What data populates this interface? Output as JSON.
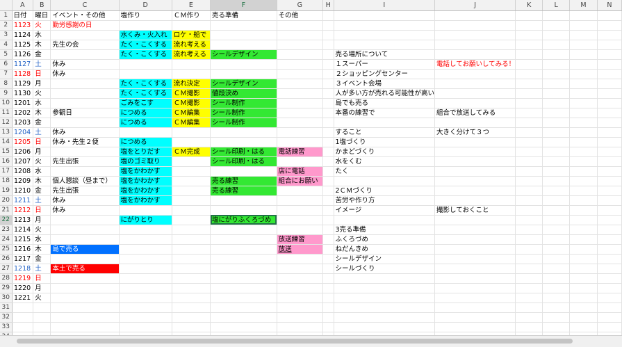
{
  "columns": [
    "",
    "A",
    "B",
    "C",
    "D",
    "E",
    "F",
    "G",
    "H",
    "I",
    "J",
    "K",
    "L",
    "M",
    "N"
  ],
  "colors": {
    "cyan": "#00ffff",
    "yellow": "#ffff00",
    "green": "#33e833",
    "pink": "#ff99cc",
    "blue": "#0070ff",
    "red": "#ff0000",
    "weekend_blue": "#1f5fc4"
  },
  "active_cell": "F22",
  "rows": [
    {
      "n": 1,
      "A": "日付",
      "B": "曜日",
      "C": "イベント・その他",
      "D": "塩作り",
      "E": "ＣＭ作り",
      "F": "売る準備",
      "G": "その他"
    },
    {
      "n": 2,
      "A": "1123",
      "B": "火",
      "C": "勤労感謝の日",
      "red": true
    },
    {
      "n": 3,
      "A": "1124",
      "B": "水",
      "D": "水くみ・火入れ",
      "E": "ロケ・船で"
    },
    {
      "n": 4,
      "A": "1125",
      "B": "木",
      "C": "先生の会",
      "D": "たく・こくする",
      "E": "流れ考える"
    },
    {
      "n": 5,
      "A": "1126",
      "B": "金",
      "D": "たく・こくする",
      "E": "流れ考える",
      "F": "シールデザイン",
      "I": "売る場所について"
    },
    {
      "n": 6,
      "A": "1127",
      "B": "土",
      "C": "休み",
      "I": "１スーパー",
      "J": "電話してお願いしてみる！",
      "sat": true
    },
    {
      "n": 7,
      "A": "1128",
      "B": "日",
      "C": "休み",
      "I": "２ショッピングセンター",
      "red": true
    },
    {
      "n": 8,
      "A": "1129",
      "B": "月",
      "D": "たく・こくする",
      "E": "流れ決定",
      "F": "シールデザイン",
      "I": "３イベント会場"
    },
    {
      "n": 9,
      "A": "1130",
      "B": "火",
      "D": "たく・こくする",
      "E": "ＣＭ撮影",
      "F": "値段決め",
      "I": "人が多い方が売れる可能性が高い"
    },
    {
      "n": 10,
      "A": "1201",
      "B": "水",
      "D": "ごみをこす",
      "E": "ＣＭ撮影",
      "F": "シール制作",
      "I": "島でも売る"
    },
    {
      "n": 11,
      "A": "1202",
      "B": "木",
      "C": "参観日",
      "D": "につめる",
      "E": "ＣＭ編集",
      "F": "シール制作",
      "I": "本番の練習で",
      "J": "組合で放送してみる"
    },
    {
      "n": 12,
      "A": "1203",
      "B": "金",
      "D": "につめる",
      "E": "ＣＭ編集",
      "F": "シール制作"
    },
    {
      "n": 13,
      "A": "1204",
      "B": "土",
      "C": "休み",
      "I": "すること",
      "J": "大きく分けて３つ",
      "sat": true
    },
    {
      "n": 14,
      "A": "1205",
      "B": "日",
      "C": "休み・先生２便",
      "D": "につめる",
      "I": "1塩づくり",
      "red": true
    },
    {
      "n": 15,
      "A": "1206",
      "B": "月",
      "D": "塩をとりだす",
      "E": "ＣＭ完成",
      "F": "シール印刷・はる",
      "G": "電話練習",
      "I": "かまどづくり"
    },
    {
      "n": 16,
      "A": "1207",
      "B": "火",
      "C": "先生出張",
      "D": "塩のゴミ取り",
      "F": "シール印刷・はる",
      "I": "水をくむ"
    },
    {
      "n": 17,
      "A": "1208",
      "B": "水",
      "D": "塩をかわかす",
      "G": "店に電話",
      "I": "たく"
    },
    {
      "n": 18,
      "A": "1209",
      "B": "木",
      "C": "個人懇談（昼まで）",
      "D": "塩をかわかす",
      "F": "売る練習",
      "G": "組合にお願い"
    },
    {
      "n": 19,
      "A": "1210",
      "B": "金",
      "C": "先生出張",
      "D": "塩をかわかす",
      "F": "売る練習",
      "I": "2ＣＭづくり"
    },
    {
      "n": 20,
      "A": "1211",
      "B": "土",
      "C": "休み",
      "D": "塩をかわかす",
      "I": "苦労や作り方",
      "sat": true
    },
    {
      "n": 21,
      "A": "1212",
      "B": "日",
      "C": "休み",
      "I": "イメージ",
      "J": "撮影しておくこと",
      "red": true
    },
    {
      "n": 22,
      "A": "1213",
      "B": "月",
      "D": "にがりとり",
      "F": "塩にがりふくろづめ"
    },
    {
      "n": 23,
      "A": "1214",
      "B": "火",
      "I": "3売る準備"
    },
    {
      "n": 24,
      "A": "1215",
      "B": "水",
      "G": "放送練習",
      "I": "ふくろづめ"
    },
    {
      "n": 25,
      "A": "1216",
      "B": "木",
      "C": "島で売る",
      "G": "放送",
      "I": "ねだんきめ"
    },
    {
      "n": 26,
      "A": "1217",
      "B": "金",
      "I": "シールデザイン"
    },
    {
      "n": 27,
      "A": "1218",
      "B": "土",
      "C": "本土で売る",
      "I": "シールづくり",
      "sat": true
    },
    {
      "n": 28,
      "A": "1219",
      "B": "日",
      "red": true
    },
    {
      "n": 29,
      "A": "1220",
      "B": "月"
    },
    {
      "n": 30,
      "A": "1221",
      "B": "火"
    },
    {
      "n": 31
    },
    {
      "n": 32
    },
    {
      "n": 33
    },
    {
      "n": 34
    }
  ]
}
